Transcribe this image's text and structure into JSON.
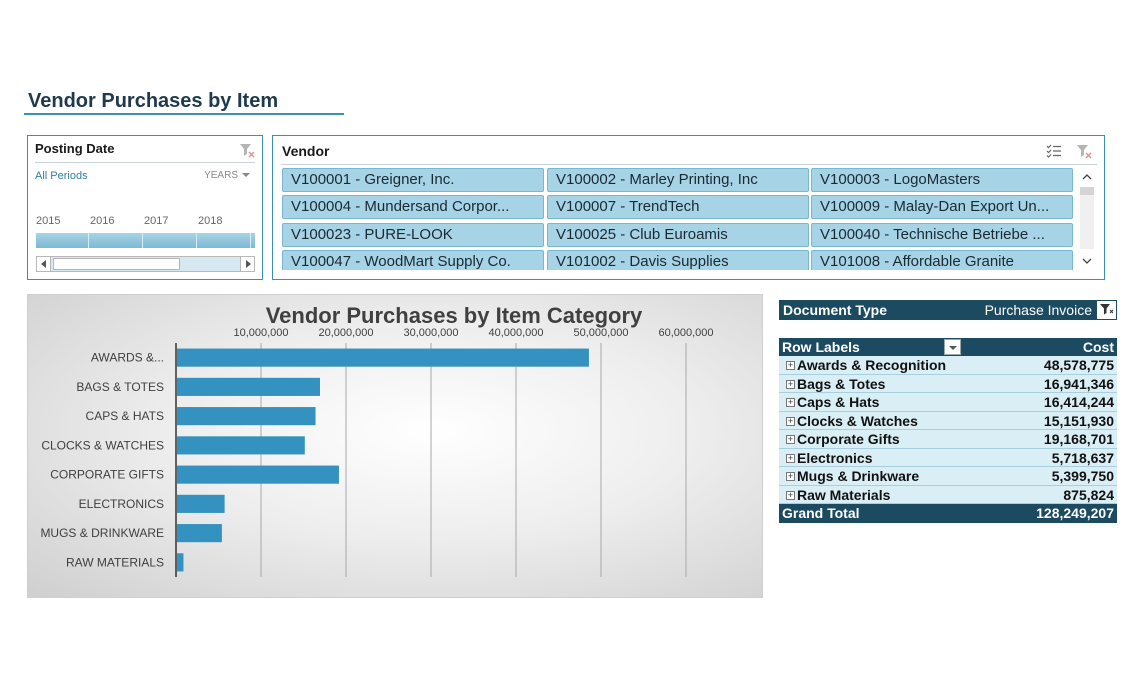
{
  "page_title": "Vendor Purchases by Item",
  "timeline": {
    "title": "Posting Date",
    "periods_label": "All Periods",
    "level_label": "YEARS",
    "years": [
      "2015",
      "2016",
      "2017",
      "2018"
    ]
  },
  "vendor": {
    "title": "Vendor",
    "items": [
      "V100001 - Greigner, Inc.",
      "V100002 - Marley Printing, Inc",
      "V100003 - LogoMasters",
      "V100004 - Mundersand Corpor...",
      "V100007 - TrendTech",
      "V100009 - Malay-Dan Export Un...",
      "V100023 - PURE-LOOK",
      "V100025 - Club Euroamis",
      "V100040 - Technische Betriebe ...",
      "V100047 - WoodMart Supply Co.",
      "V101002 - Davis Supplies",
      "V101008 - Affordable Granite"
    ]
  },
  "chart_data": {
    "type": "bar",
    "orientation": "horizontal",
    "title": "Vendor Purchases by Item Category",
    "categories": [
      "AWARDS &...",
      "BAGS & TOTES",
      "CAPS & HATS",
      "CLOCKS & WATCHES",
      "CORPORATE GIFTS",
      "ELECTRONICS",
      "MUGS & DRINKWARE",
      "RAW MATERIALS"
    ],
    "values": [
      48578775,
      16941346,
      16414244,
      15151930,
      19168701,
      5718637,
      5399750,
      875824
    ],
    "x_ticks": [
      "10,000,000",
      "20,000,000",
      "30,000,000",
      "40,000,000",
      "50,000,000",
      "60,000,000"
    ],
    "xlim": [
      0,
      60000000
    ],
    "grid": true,
    "bar_color": "#3392bf"
  },
  "pivot": {
    "filter_label": "Document Type",
    "filter_value": "Purchase Invoice",
    "row_labels_header": "Row Labels",
    "cost_header": "Cost",
    "expand_symbol": "+",
    "rows": [
      {
        "label": "Awards & Recognition",
        "value": "48,578,775"
      },
      {
        "label": "Bags & Totes",
        "value": "16,941,346"
      },
      {
        "label": "Caps & Hats",
        "value": "16,414,244"
      },
      {
        "label": "Clocks & Watches",
        "value": "15,151,930"
      },
      {
        "label": "Corporate Gifts",
        "value": "19,168,701"
      },
      {
        "label": "Electronics",
        "value": "5,718,637"
      },
      {
        "label": "Mugs & Drinkware",
        "value": "5,399,750"
      },
      {
        "label": "Raw Materials",
        "value": "875,824"
      }
    ],
    "grand_total_label": "Grand Total",
    "grand_total_value": "128,249,207"
  }
}
